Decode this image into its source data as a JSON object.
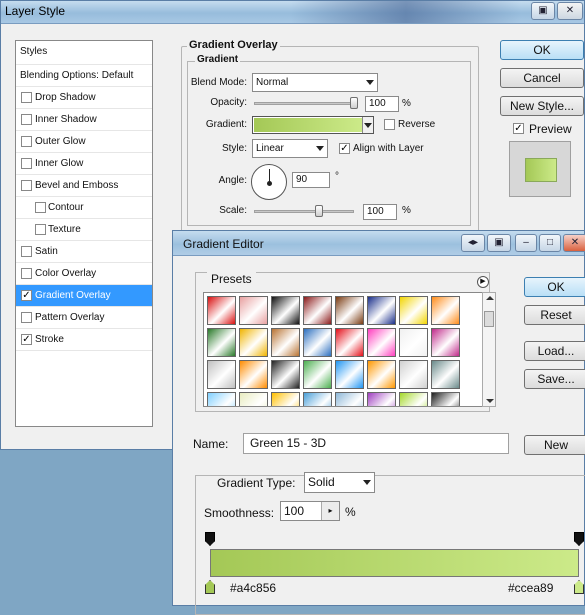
{
  "layer_style": {
    "title": "Layer Style",
    "styles_header": "Styles",
    "styles": [
      {
        "label": "Blending Options: Default",
        "checkbox": false,
        "checked": false,
        "selected": false,
        "sub": false,
        "header": true
      },
      {
        "label": "Drop Shadow",
        "checkbox": true,
        "checked": false,
        "selected": false,
        "sub": false
      },
      {
        "label": "Inner Shadow",
        "checkbox": true,
        "checked": false,
        "selected": false,
        "sub": false
      },
      {
        "label": "Outer Glow",
        "checkbox": true,
        "checked": false,
        "selected": false,
        "sub": false
      },
      {
        "label": "Inner Glow",
        "checkbox": true,
        "checked": false,
        "selected": false,
        "sub": false
      },
      {
        "label": "Bevel and Emboss",
        "checkbox": true,
        "checked": false,
        "selected": false,
        "sub": false
      },
      {
        "label": "Contour",
        "checkbox": true,
        "checked": false,
        "selected": false,
        "sub": true
      },
      {
        "label": "Texture",
        "checkbox": true,
        "checked": false,
        "selected": false,
        "sub": true
      },
      {
        "label": "Satin",
        "checkbox": true,
        "checked": false,
        "selected": false,
        "sub": false
      },
      {
        "label": "Color Overlay",
        "checkbox": true,
        "checked": false,
        "selected": false,
        "sub": false
      },
      {
        "label": "Gradient Overlay",
        "checkbox": true,
        "checked": true,
        "selected": true,
        "sub": false
      },
      {
        "label": "Pattern Overlay",
        "checkbox": true,
        "checked": false,
        "selected": false,
        "sub": false
      },
      {
        "label": "Stroke",
        "checkbox": true,
        "checked": true,
        "selected": false,
        "sub": false
      }
    ],
    "gradient_overlay": {
      "heading": "Gradient Overlay",
      "subheading": "Gradient",
      "blend_mode_label": "Blend Mode:",
      "blend_mode_value": "Normal",
      "opacity_label": "Opacity:",
      "opacity_value": "100",
      "opacity_unit": "%",
      "opacity_fraction": 1.0,
      "gradient_label": "Gradient:",
      "reverse_label": "Reverse",
      "reverse_checked": false,
      "style_label": "Style:",
      "style_value": "Linear",
      "align_label": "Align with Layer",
      "align_checked": true,
      "angle_label": "Angle:",
      "angle_value": "90",
      "angle_unit": "°",
      "scale_label": "Scale:",
      "scale_value": "100",
      "scale_unit": "%",
      "scale_fraction": 0.66
    },
    "buttons": {
      "ok": "OK",
      "cancel": "Cancel",
      "new_style": "New Style...",
      "preview_label": "Preview",
      "preview_checked": true
    },
    "window_buttons": [
      "minimize-icon",
      "close-icon"
    ]
  },
  "gradient_editor": {
    "title": "Gradient Editor",
    "presets_label": "Presets",
    "presets_menu_icon": "play-triangle-icon",
    "name_label": "Name:",
    "name_value": "Green 15 - 3D",
    "gradient_type_label": "Gradient Type:",
    "gradient_type_value": "Solid",
    "smoothness_label": "Smoothness:",
    "smoothness_value": "100",
    "smoothness_unit": "%",
    "buttons": {
      "ok": "OK",
      "reset": "Reset",
      "load": "Load...",
      "save": "Save...",
      "new": "New"
    },
    "color_stops": [
      {
        "position": 0.0,
        "color": "#a4c856",
        "label": "#a4c856"
      },
      {
        "position": 1.0,
        "color": "#ccea89",
        "label": "#ccea89"
      }
    ],
    "opacity_stops": [
      {
        "position": 0.0
      },
      {
        "position": 1.0
      }
    ],
    "preset_swatches": [
      [
        "#d91010",
        "#e8a0a0",
        "#111111",
        "#8b1a1a",
        "#7a3b12",
        "#1a2f8a",
        "#f2d500",
        "#ff8c1a"
      ],
      [
        "#2a7a2a",
        "#f0b400",
        "#b87333",
        "#2c6fbf",
        "#e4101a",
        "#ff3fbf",
        "#f0f0f0",
        "#c02a8a"
      ],
      [
        "#c0c0c0",
        "#ff8c00",
        "#222222",
        "#4caf50",
        "#2196f3",
        "#ff9800",
        "#d0d0d0",
        "#6a8a8a"
      ],
      [
        "#80d0ff",
        "#e8ecc0",
        "#ffc000",
        "#4a9fd8",
        "#8fb8d8",
        "#a040c0",
        "#a4d82a",
        "#202020"
      ]
    ]
  }
}
